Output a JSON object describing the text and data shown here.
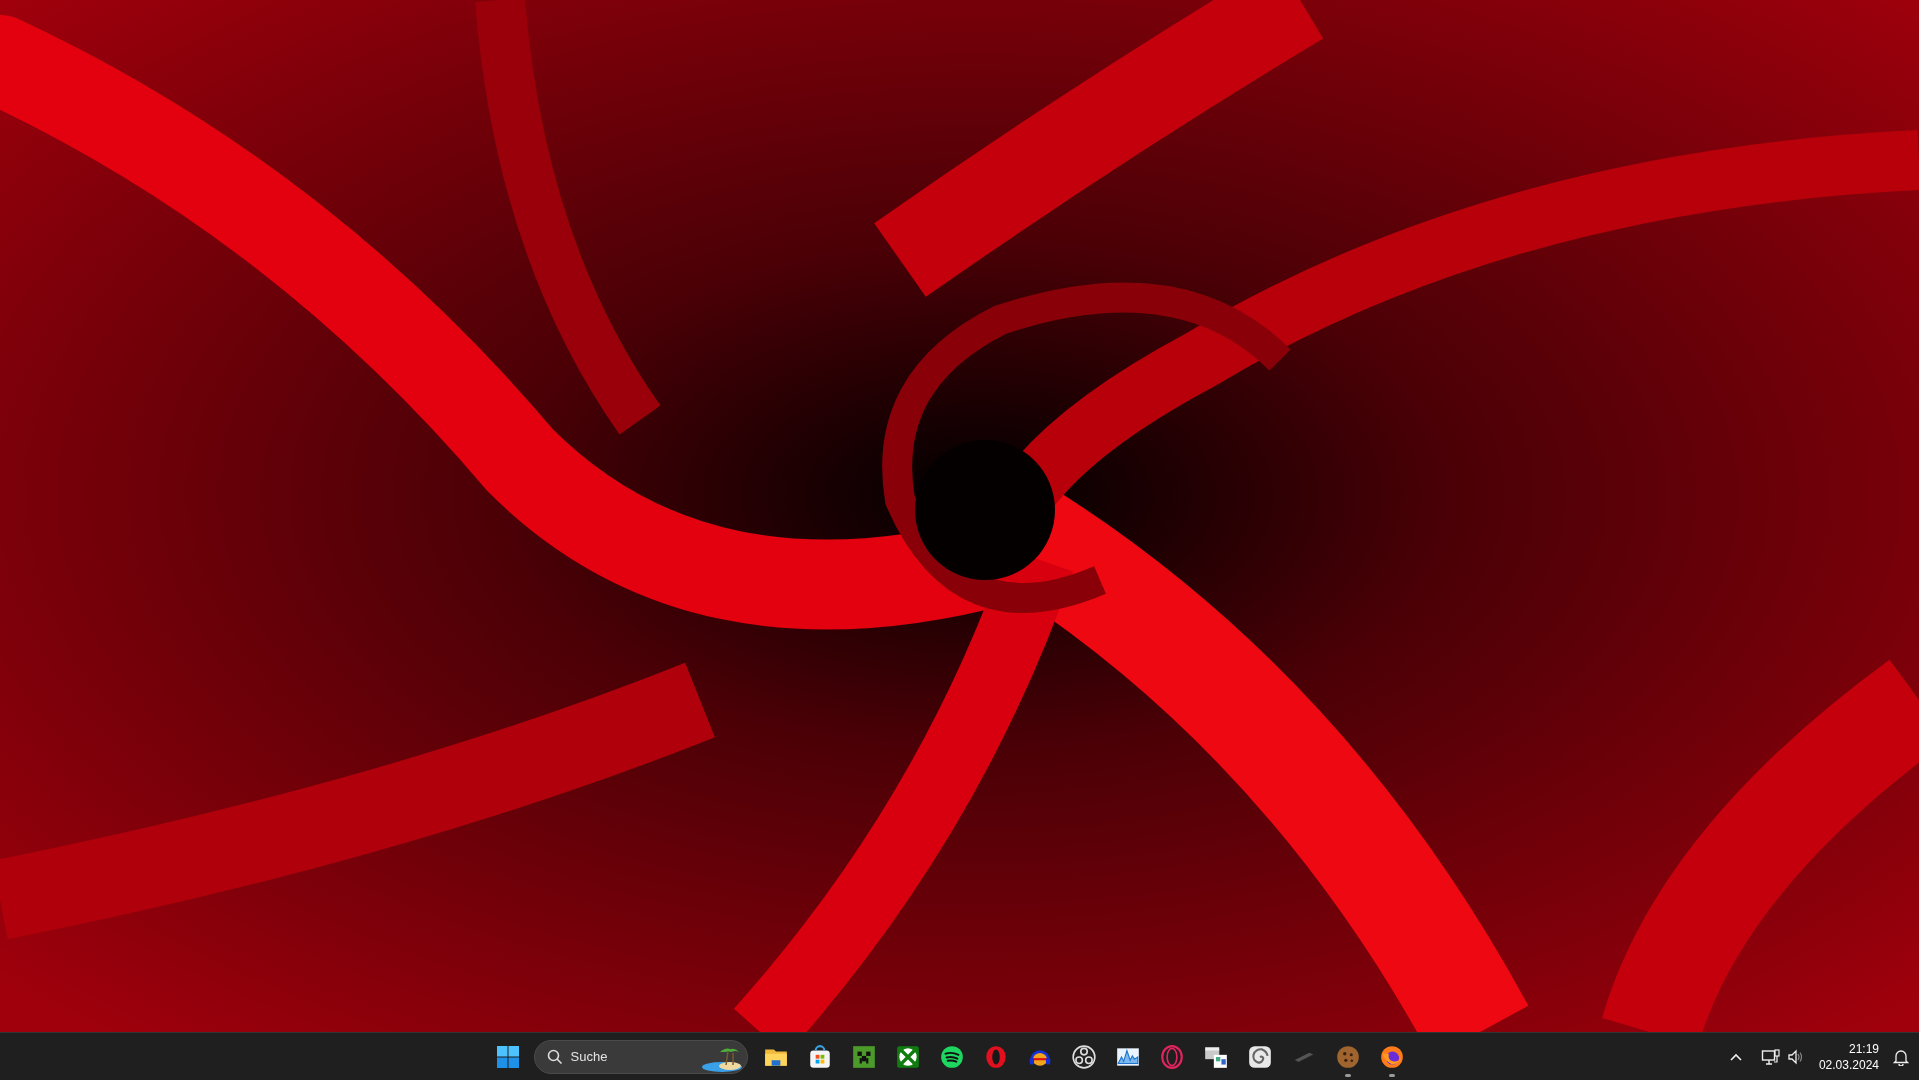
{
  "taskbar": {
    "search": {
      "placeholder": "Suche"
    },
    "apps": [
      {
        "kind": "folder",
        "running": false
      },
      {
        "kind": "store",
        "running": false
      },
      {
        "kind": "block",
        "running": false
      },
      {
        "kind": "xbox",
        "running": false
      },
      {
        "kind": "spotify",
        "running": false
      },
      {
        "kind": "opera",
        "running": false
      },
      {
        "kind": "headphones",
        "running": false
      },
      {
        "kind": "obs",
        "running": false
      },
      {
        "kind": "graph",
        "running": false
      },
      {
        "kind": "ring",
        "running": false
      },
      {
        "kind": "scanner",
        "running": false
      },
      {
        "kind": "spiral",
        "running": false
      },
      {
        "kind": "stylus",
        "running": false
      },
      {
        "kind": "cookie",
        "running": true
      },
      {
        "kind": "firefox",
        "running": true
      }
    ],
    "tray": {
      "time": "21:19",
      "date": "02.03.2024"
    }
  }
}
